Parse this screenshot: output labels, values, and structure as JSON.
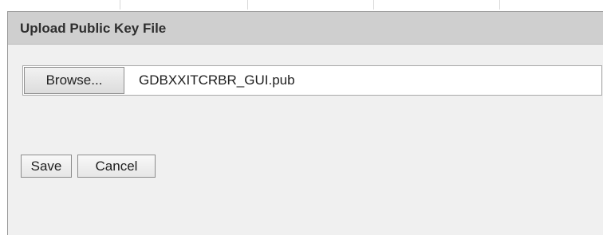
{
  "dialog": {
    "title": "Upload Public Key File"
  },
  "file_input": {
    "browse_label": "Browse...",
    "file_name": "GDBXXITCRBR_GUI.pub"
  },
  "actions": {
    "save_label": "Save",
    "cancel_label": "Cancel"
  },
  "colors": {
    "header_background": "#cfcfcf",
    "panel_background": "#f0f0f0",
    "border": "#9a9a9a"
  }
}
